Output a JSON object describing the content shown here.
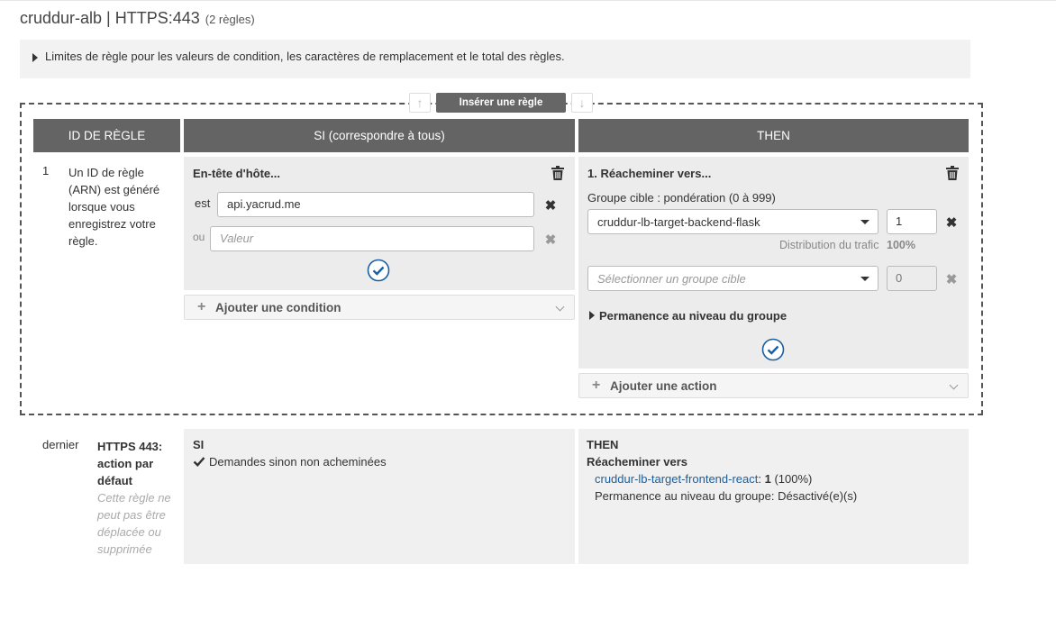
{
  "header": {
    "title": "cruddur-alb | HTTPS:443",
    "rule_count": "(2 règles)"
  },
  "limits_text": "Limites de règle pour les valeurs de condition, les caractères de remplacement et le total des règles.",
  "insert_rule_label": "Insérer une règle",
  "table_headers": {
    "rule_id": "ID DE RÈGLE",
    "if": "SI (correspondre à tous)",
    "then": "THEN"
  },
  "rule1": {
    "number": "1",
    "id_text": "Un ID de règle (ARN) est généré lorsque vous enregistrez votre règle.",
    "condition": {
      "title": "En-tête d'hôte...",
      "is_label": "est",
      "is_value": "api.yacrud.me",
      "or_label": "ou",
      "or_placeholder": "Valeur"
    },
    "add_condition_label": "Ajouter une condition",
    "action": {
      "title": "1. Réacheminer vers...",
      "weight_label": "Groupe cible : pondération (0 à 999)",
      "target_group": "cruddur-lb-target-backend-flask",
      "target_weight": "1",
      "distribution_label": "Distribution du trafic",
      "distribution_value": "100%",
      "target_placeholder": "Sélectionner un groupe cible",
      "placeholder_weight": "0",
      "stickiness_label": "Permanence au niveau du groupe"
    },
    "add_action_label": "Ajouter une action"
  },
  "default_rule": {
    "number": "dernier",
    "title": "HTTPS 443: action par défaut",
    "note": "Cette règle ne peut pas être déplacée ou supprimée",
    "if_heading": "SI",
    "if_text": "Demandes sinon non acheminées",
    "then_heading": "THEN",
    "forward_label": "Réacheminer vers",
    "target_link": "cruddur-lb-target-frontend-react",
    "target_colon": ":",
    "target_weight": "1",
    "target_percent": "(100%)",
    "stickiness_text": "Permanence au niveau du groupe: Désactivé(e)(s)"
  },
  "icons": [
    "caret-right-icon",
    "arrow-up-icon",
    "arrow-down-icon",
    "trash-icon",
    "close-icon",
    "check-circle-icon",
    "plus-icon",
    "chevron-down-icon",
    "dropdown-caret-icon",
    "checkmark-icon"
  ],
  "colors": {
    "header_bg": "#646464",
    "panel_bg": "#ececec",
    "link": "#1a5fa0",
    "accent": "#1a5fa0"
  }
}
